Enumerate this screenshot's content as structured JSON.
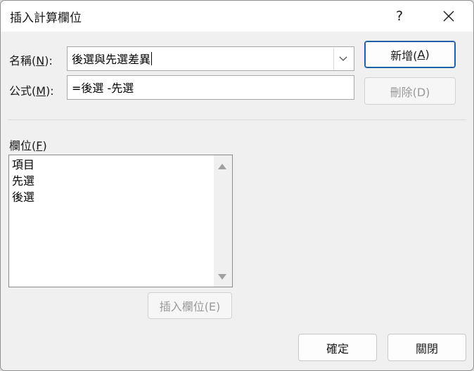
{
  "title": "插入計算欄位",
  "title_buttons": {
    "help": "?",
    "close": "✕"
  },
  "name_field": {
    "label_prefix": "名稱(",
    "label_key": "N",
    "label_suffix": "):",
    "value": "後選與先選差異"
  },
  "formula_field": {
    "label_prefix": "公式(",
    "label_key": "M",
    "label_suffix": "):",
    "value": "=後選 -先選"
  },
  "buttons": {
    "add_prefix": "新增(",
    "add_key": "A",
    "add_suffix": ")",
    "delete": "刪除(D)",
    "insert_field": "插入欄位(E)",
    "ok": "確定",
    "close": "關閉"
  },
  "fields": {
    "label_prefix": "欄位(",
    "label_key": "F",
    "label_suffix": ")",
    "items": [
      "項目",
      "先選",
      "後選"
    ]
  },
  "icons": [
    "help-icon",
    "close-icon",
    "chevron-down-icon",
    "scroll-up-icon",
    "scroll-down-icon"
  ],
  "colors": {
    "default_button_border": "#1e5faa",
    "dialog_bg": "#f0f0f0"
  }
}
